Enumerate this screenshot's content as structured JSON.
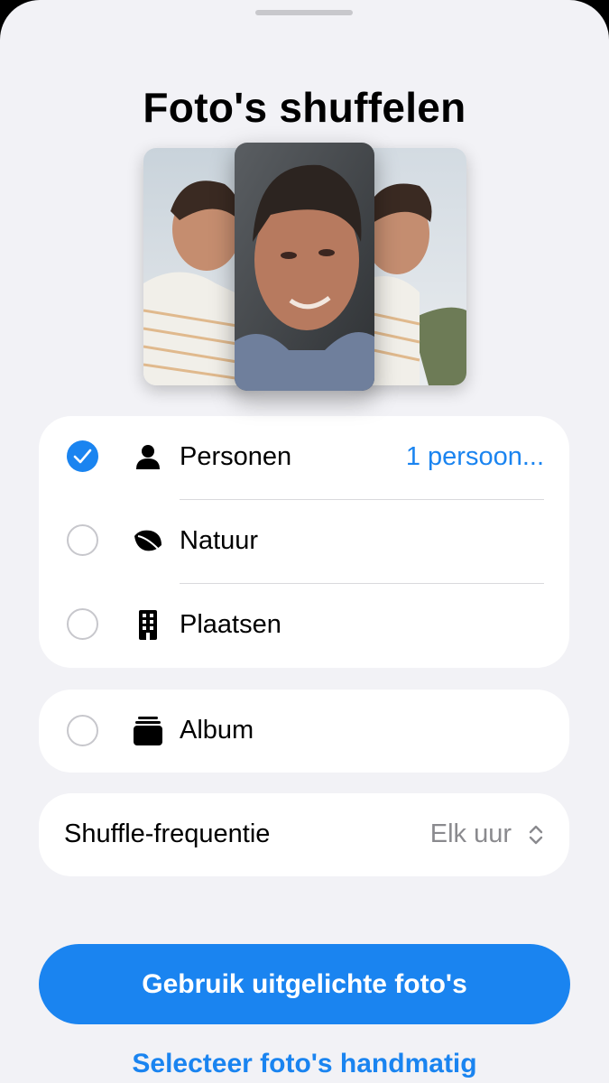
{
  "title": "Foto's shuffelen",
  "options": [
    {
      "label": "Personen",
      "detail": "1 persoon...",
      "icon": "person-icon",
      "checked": true
    },
    {
      "label": "Natuur",
      "icon": "leaf-icon",
      "checked": false
    },
    {
      "label": "Plaatsen",
      "icon": "building-icon",
      "checked": false
    }
  ],
  "album": {
    "label": "Album",
    "icon": "stack-icon",
    "checked": false
  },
  "frequency": {
    "label": "Shuffle-frequentie",
    "value": "Elk uur"
  },
  "buttons": {
    "primary": "Gebruik uitgelichte foto's",
    "secondary": "Selecteer foto's handmatig"
  },
  "colors": {
    "accent": "#1a84f0",
    "background": "#f2f2f6"
  }
}
